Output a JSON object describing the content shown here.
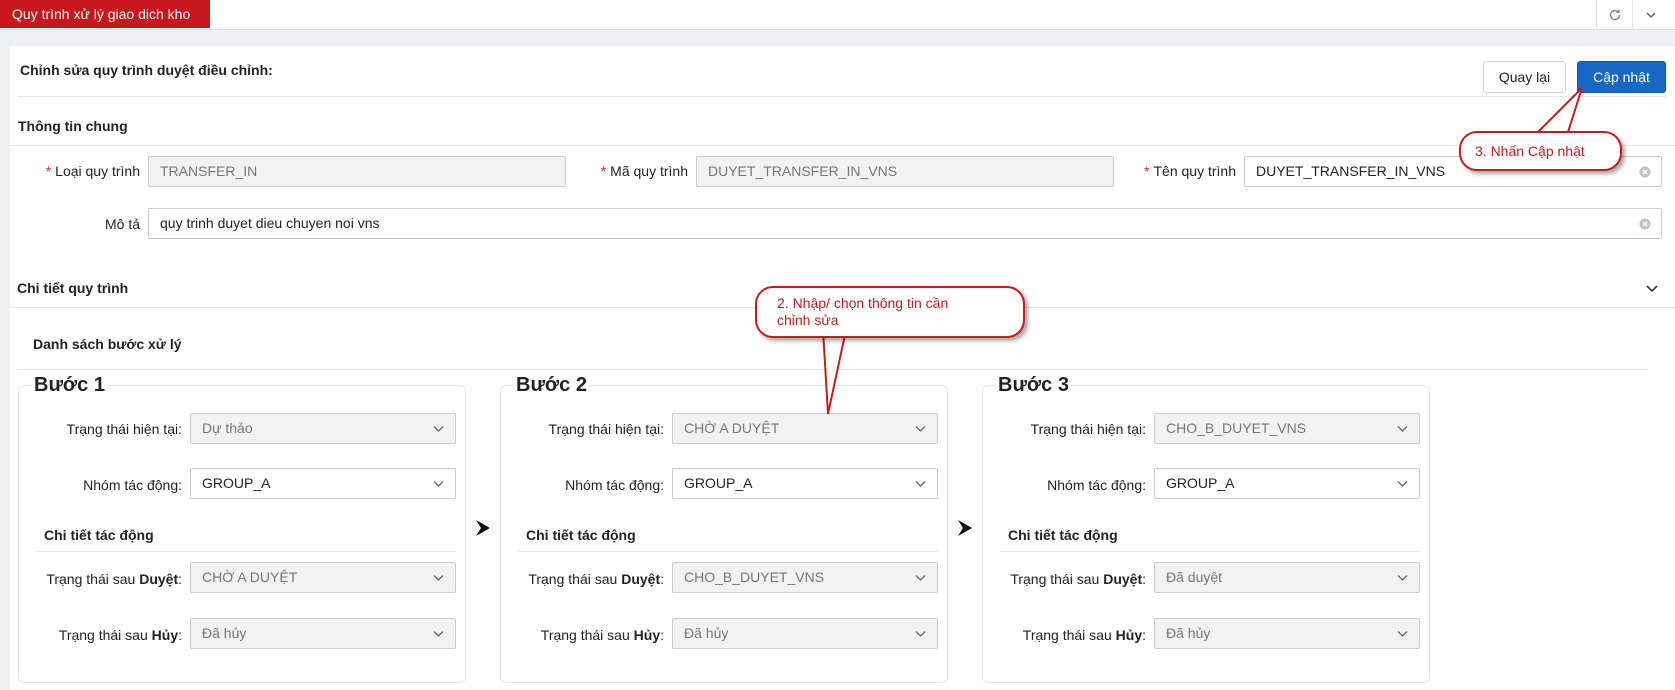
{
  "topbar": {
    "tab_label": "Quy trình xử lý giao dịch kho",
    "refresh_icon": "refresh-icon",
    "collapse_icon": "chevron-down-icon"
  },
  "header": {
    "title": "Chỉnh sửa quy trình duyệt điều chỉnh:",
    "back_label": "Quay lại",
    "update_label": "Cập nhật"
  },
  "general": {
    "title": "Thông tin chung",
    "process_type_label": "Loại quy trình",
    "process_type_value": "TRANSFER_IN",
    "process_code_label": "Mã quy trình",
    "process_code_value": "DUYET_TRANSFER_IN_VNS",
    "process_name_label": "Tên quy trình",
    "process_name_value": "DUYET_TRANSFER_IN_VNS",
    "description_label": "Mô tả",
    "description_value": "quy trinh duyet dieu chuyen noi vns",
    "required_mark": "*"
  },
  "details": {
    "title": "Chi tiết quy trình",
    "list_title": "Danh sách bước xử lý"
  },
  "step_labels": {
    "current_status": "Trạng thái hiện tại:",
    "group": "Nhóm tác động:",
    "action_details": "Chi tiết tác động",
    "after_prefix": "Trạng thái sau ",
    "approve_word": "Duyệt",
    "cancel_word": "Hủy",
    "colon": ":"
  },
  "steps": [
    {
      "title": "Bước 1",
      "current_status": "Dự thảo",
      "group": "GROUP_A",
      "after_approve": "CHỜ A DUYỆT",
      "after_cancel": "Đã hủy"
    },
    {
      "title": "Bước 2",
      "current_status": "CHỜ A DUYỆT",
      "group": "GROUP_A",
      "after_approve": "CHO_B_DUYET_VNS",
      "after_cancel": "Đã hủy"
    },
    {
      "title": "Bước 3",
      "current_status": "CHO_B_DUYET_VNS",
      "group": "GROUP_A",
      "after_approve": "Đã duyệt",
      "after_cancel": "Đã hủy"
    }
  ],
  "callouts": {
    "edit_line1": "2. Nhập/ chọn thông tin cần",
    "edit_line2": "chỉnh sửa",
    "update": "3. Nhấn Cập nhật"
  },
  "colors": {
    "brand_red": "#c8161d",
    "primary_blue": "#1767c4",
    "callout_red": "#c51b22"
  }
}
